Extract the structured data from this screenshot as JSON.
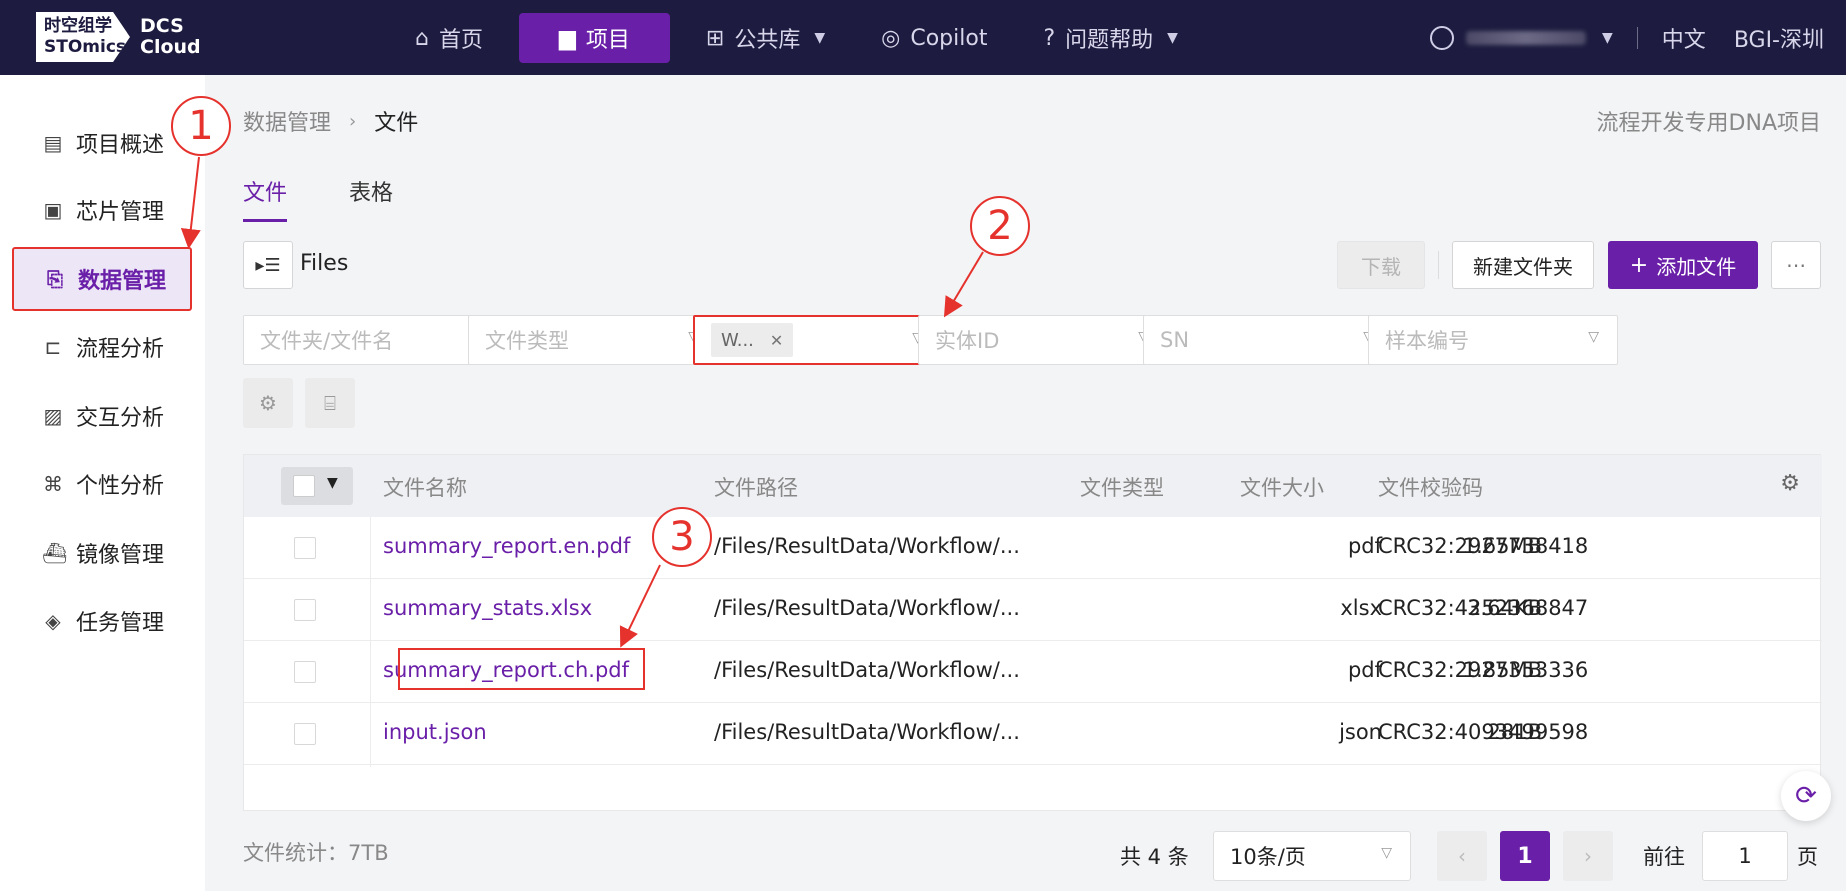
{
  "logo": {
    "line1": "时空组学",
    "line2": "STOmics",
    "dcs1": "DCS",
    "dcs2": "Cloud"
  },
  "nav": [
    {
      "label": "首页",
      "icon": "⌂"
    },
    {
      "label": "项目",
      "icon": "▆"
    },
    {
      "label": "公共库",
      "icon": "⊞"
    },
    {
      "label": "Copilot",
      "icon": "◎"
    },
    {
      "label": "问题帮助",
      "icon": "?"
    }
  ],
  "top_right": {
    "language": "中文",
    "region": "BGI-深圳"
  },
  "sidebar": [
    {
      "label": "项目概述",
      "icon": "▤"
    },
    {
      "label": "芯片管理",
      "icon": "▣"
    },
    {
      "label": "数据管理",
      "icon": "⎘"
    },
    {
      "label": "流程分析",
      "icon": "⊏"
    },
    {
      "label": "交互分析",
      "icon": "▨"
    },
    {
      "label": "个性分析",
      "icon": "⌘"
    },
    {
      "label": "镜像管理",
      "icon": "⛴"
    },
    {
      "label": "任务管理",
      "icon": "◈"
    }
  ],
  "breadcrumb": {
    "parent": "数据管理",
    "current": "文件"
  },
  "project_name": "流程开发专用DNA项目",
  "tabs": [
    "文件",
    "表格"
  ],
  "files_label": "Files",
  "buttons": {
    "download": "下载",
    "new_folder": "新建文件夹",
    "add_file": "添加文件"
  },
  "filters": {
    "name_placeholder": "文件夹/文件名",
    "type_placeholder": "文件类型",
    "tag_value": "W...",
    "entity_placeholder": "实体ID",
    "sn_placeholder": "SN",
    "sample_placeholder": "样本编号"
  },
  "table": {
    "headers": [
      "文件名称",
      "文件路径",
      "文件类型",
      "文件大小",
      "文件校验码"
    ],
    "rows": [
      {
        "name": "summary_report.en.pdf",
        "path": "/Files/ResultData/Workflow/...",
        "type": "pdf",
        "size": "1.65MB",
        "checksum": "CRC32:2927738418"
      },
      {
        "name": "summary_stats.xlsx",
        "path": "/Files/ResultData/Workflow/...",
        "type": "xlsx",
        "size": "3.64KB",
        "checksum": "CRC32:4252368847"
      },
      {
        "name": "summary_report.ch.pdf",
        "path": "/Files/ResultData/Workflow/...",
        "type": "pdf",
        "size": "1.85MB",
        "checksum": "CRC32:2927353336"
      },
      {
        "name": "input.json",
        "path": "/Files/ResultData/Workflow/...",
        "type": "json",
        "size": "281B",
        "checksum": "CRC32:4093499598"
      }
    ]
  },
  "stats": "文件统计：7TB",
  "pagination": {
    "total": "共 4 条",
    "page_size": "10条/页",
    "current_page": "1",
    "goto_label": "前往",
    "goto_value": "1",
    "goto_suffix": "页"
  },
  "annotations": [
    "1",
    "2",
    "3"
  ],
  "colors": {
    "brand": "#6a1fa8",
    "topbar": "#1d1b3f",
    "annotation": "#e5322d"
  }
}
